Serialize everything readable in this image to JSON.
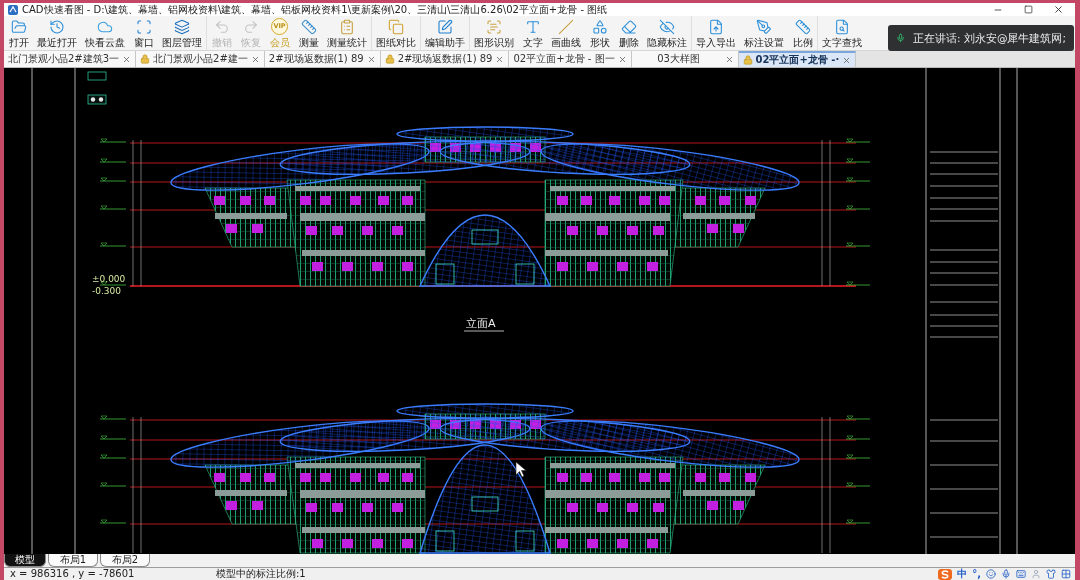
{
  "window": {
    "title": "CAD快速看图 - D:\\建筑、幕墙、铝网校资料\\建筑、幕墙、铝板网校资料1\\更新案例\\20、三清山\\三清山6.26\\02平立面+龙骨 - 图纸"
  },
  "toolbar": {
    "groups": [
      {
        "items": [
          {
            "label": "打开",
            "kind": "tool",
            "disabled": false
          },
          {
            "label": "最近打开",
            "kind": "tool",
            "disabled": false
          },
          {
            "label": "快看云盘",
            "kind": "tool",
            "disabled": false
          },
          {
            "label": "窗口",
            "kind": "tool",
            "disabled": false
          },
          {
            "label": "图层管理",
            "kind": "tool",
            "disabled": false
          }
        ]
      },
      {
        "items": [
          {
            "label": "撤销",
            "kind": "tool",
            "disabled": true
          },
          {
            "label": "恢复",
            "kind": "tool",
            "disabled": true
          },
          {
            "label": "会员",
            "kind": "vip",
            "badge": "VIP",
            "disabled": false
          },
          {
            "label": "测量",
            "kind": "tool",
            "disabled": false
          },
          {
            "label": "测量统计",
            "kind": "tool",
            "disabled": false
          }
        ]
      },
      {
        "items": [
          {
            "label": "图纸对比",
            "kind": "tool",
            "disabled": false
          }
        ]
      },
      {
        "items": [
          {
            "label": "编辑助手",
            "kind": "tool",
            "disabled": false
          }
        ]
      },
      {
        "items": [
          {
            "label": "图形识别",
            "kind": "tool",
            "disabled": false
          },
          {
            "label": "文字",
            "kind": "tool",
            "disabled": false
          },
          {
            "label": "画曲线",
            "kind": "tool",
            "disabled": false
          },
          {
            "label": "形状",
            "kind": "tool",
            "disabled": false
          },
          {
            "label": "删除",
            "kind": "tool",
            "disabled": false
          },
          {
            "label": "隐藏标注",
            "kind": "tool",
            "disabled": false
          }
        ]
      },
      {
        "items": [
          {
            "label": "导入导出",
            "kind": "tool",
            "disabled": false
          },
          {
            "label": "标注设置",
            "kind": "tool",
            "disabled": false
          },
          {
            "label": "比例",
            "kind": "tool",
            "disabled": false
          }
        ]
      },
      {
        "items": [
          {
            "label": "文字查找",
            "kind": "tool",
            "disabled": false
          }
        ]
      }
    ]
  },
  "call_notification": {
    "text": "正在讲话: 刘永安@犀牛建筑网;"
  },
  "document_tabs": [
    {
      "label": "北门景观小品2#建筑3一",
      "locked": false,
      "selected": false
    },
    {
      "label": "北门景观小品2#建一",
      "locked": true,
      "selected": false
    },
    {
      "label": "2#现场返数据(1) 89",
      "locked": false,
      "selected": false
    },
    {
      "label": "2#现场返数据(1) 89",
      "locked": true,
      "selected": false
    },
    {
      "label": "02平立面+龙骨 - 图一",
      "locked": false,
      "selected": false
    },
    {
      "label": "03大样图",
      "locked": false,
      "selected": false
    },
    {
      "label": "02平立面+龙骨 -·",
      "locked": true,
      "selected": true
    }
  ],
  "canvas": {
    "level_labels": [
      "±0.000",
      "-0.300"
    ],
    "view_title": "立面A"
  },
  "layout_tabs": [
    {
      "label": "模型",
      "selected": true
    },
    {
      "label": "布局1",
      "selected": false
    },
    {
      "label": "布局2",
      "selected": false
    }
  ],
  "status_bar": {
    "coordinates": "x = 986316 , y = -78601",
    "annotation_scale": "模型中的标注比例:1"
  },
  "ime_bar": {
    "language": "中",
    "punctuation": "°,"
  }
}
